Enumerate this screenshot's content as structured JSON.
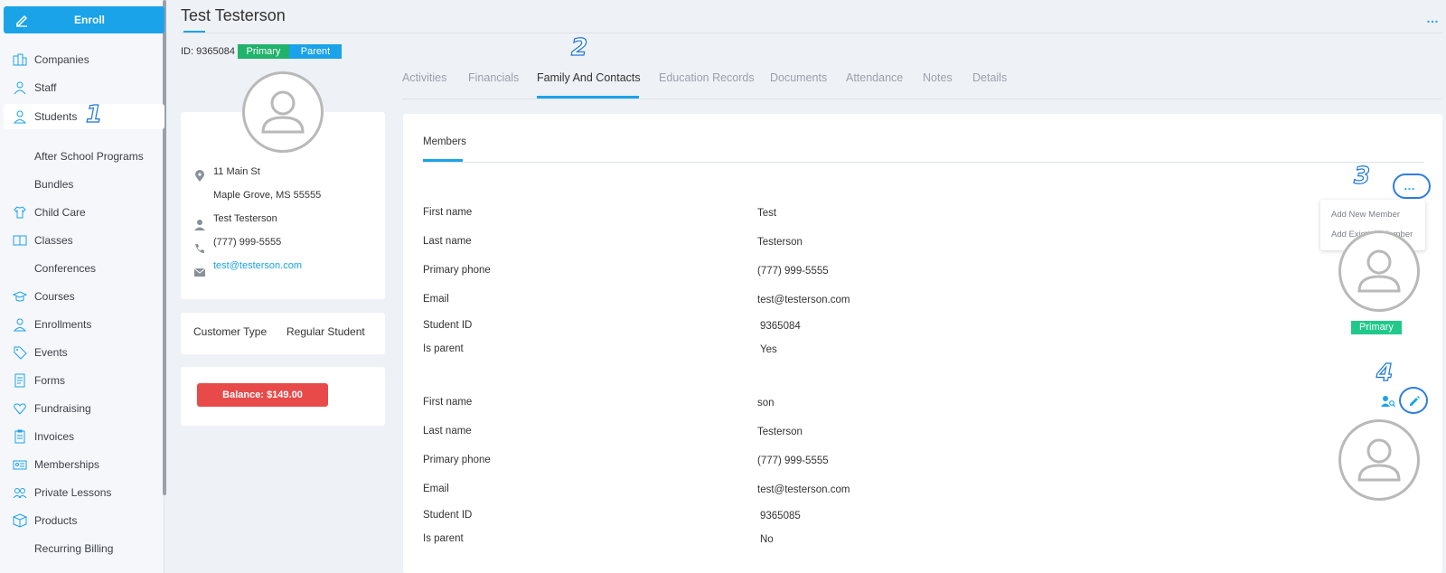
{
  "sidebar": {
    "enroll_label": "Enroll",
    "items": [
      {
        "label": "Companies",
        "icon": "building-icon"
      },
      {
        "label": "Staff",
        "icon": "staff-icon"
      },
      {
        "label": "Students",
        "icon": "user-icon"
      },
      {
        "label": "After School Programs",
        "icon": ""
      },
      {
        "label": "Bundles",
        "icon": ""
      },
      {
        "label": "Child Care",
        "icon": "shirt-icon"
      },
      {
        "label": "Classes",
        "icon": "book-icon"
      },
      {
        "label": "Conferences",
        "icon": ""
      },
      {
        "label": "Courses",
        "icon": "graduation-cap-icon"
      },
      {
        "label": "Enrollments",
        "icon": "user-icon"
      },
      {
        "label": "Events",
        "icon": "tag-icon"
      },
      {
        "label": "Forms",
        "icon": "form-icon"
      },
      {
        "label": "Fundraising",
        "icon": "heart-icon"
      },
      {
        "label": "Invoices",
        "icon": "clipboard-icon"
      },
      {
        "label": "Memberships",
        "icon": "id-card-icon"
      },
      {
        "label": "Private Lessons",
        "icon": "users-icon"
      },
      {
        "label": "Products",
        "icon": "box-icon"
      },
      {
        "label": "Recurring Billing",
        "icon": ""
      }
    ],
    "active": "Students"
  },
  "annotations": [
    "1",
    "2",
    "3",
    "4"
  ],
  "header": {
    "title": "Test Testerson",
    "more": "…"
  },
  "profile": {
    "id_text": "ID: 9365084",
    "tags": [
      "Primary",
      "Parent"
    ],
    "address_line1": "11 Main St",
    "address_line2": "Maple Grove, MS 55555",
    "contact_name": "Test Testerson",
    "phone": "(777) 999-5555",
    "email": "test@testerson.com",
    "customer_type_label": "Customer Type",
    "customer_type_value": "Regular Student",
    "balance_label": "Balance: $149.00"
  },
  "tabs": [
    "Activities",
    "Financials",
    "Family And Contacts",
    "Education Records",
    "Documents",
    "Attendance",
    "Notes",
    "Details"
  ],
  "active_tab": "Family And Contacts",
  "members_tab": "Members",
  "members_menu": {
    "more": "…",
    "items": [
      "Add New Member",
      "Add Existing Member"
    ]
  },
  "field_labels": {
    "first_name": "First name",
    "last_name": "Last name",
    "primary_phone": "Primary phone",
    "email": "Email",
    "student_id": "Student ID",
    "is_parent": "Is parent"
  },
  "members": [
    {
      "first_name": "Test",
      "last_name": "Testerson",
      "primary_phone": "(777) 999-5555",
      "email": "test@testerson.com",
      "student_id": "9365084",
      "is_parent": "Yes",
      "badge": "Primary"
    },
    {
      "first_name": "son",
      "last_name": "Testerson",
      "primary_phone": "(777) 999-5555",
      "email": "test@testerson.com",
      "student_id": "9365085",
      "is_parent": "No"
    }
  ],
  "colors": {
    "accent": "#1aa3e8",
    "primary_tag": "#20b36c",
    "balance": "#e84a4a",
    "annotation": "#1c76d6"
  }
}
